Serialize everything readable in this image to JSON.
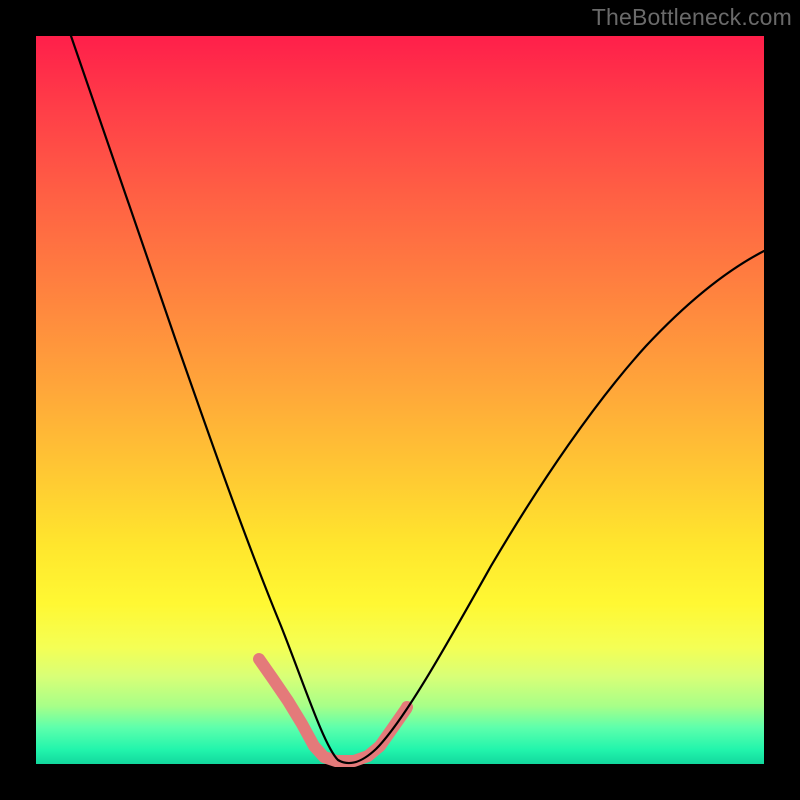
{
  "watermark": "TheBottleneck.com",
  "colors": {
    "frame": "#000000",
    "gradient_top": "#ff1f4a",
    "gradient_mid": "#ffe62d",
    "gradient_bottom": "#12d89e",
    "curve": "#000000",
    "highlight": "#e47a7a"
  },
  "chart_data": {
    "type": "line",
    "title": "",
    "xlabel": "",
    "ylabel": "",
    "xlim": [
      0,
      100
    ],
    "ylim": [
      0,
      100
    ],
    "note": "Axes unlabeled; values are approximate percentages of plot width/height. y=0 at bottom (green), y=100 at top (red). Curve has a single minimum near x≈41, y≈0.",
    "grid": false,
    "legend": false,
    "series": [
      {
        "name": "bottleneck-curve",
        "x": [
          0,
          4,
          8,
          12,
          16,
          20,
          24,
          28,
          32,
          36,
          40,
          44,
          48,
          52,
          56,
          60,
          64,
          68,
          72,
          76,
          80,
          84,
          88,
          92,
          96,
          100
        ],
        "y": [
          100,
          91,
          82,
          73,
          64,
          55,
          46,
          37,
          27,
          16,
          3,
          0,
          4,
          11,
          18,
          25,
          32,
          38,
          44,
          49,
          54,
          58,
          62,
          65,
          68,
          70
        ]
      }
    ],
    "highlight_region": {
      "name": "valley-highlight",
      "x_range": [
        31,
        51
      ],
      "description": "Thick pink segment marking the bottom of the valley and lower slopes on both sides."
    }
  }
}
